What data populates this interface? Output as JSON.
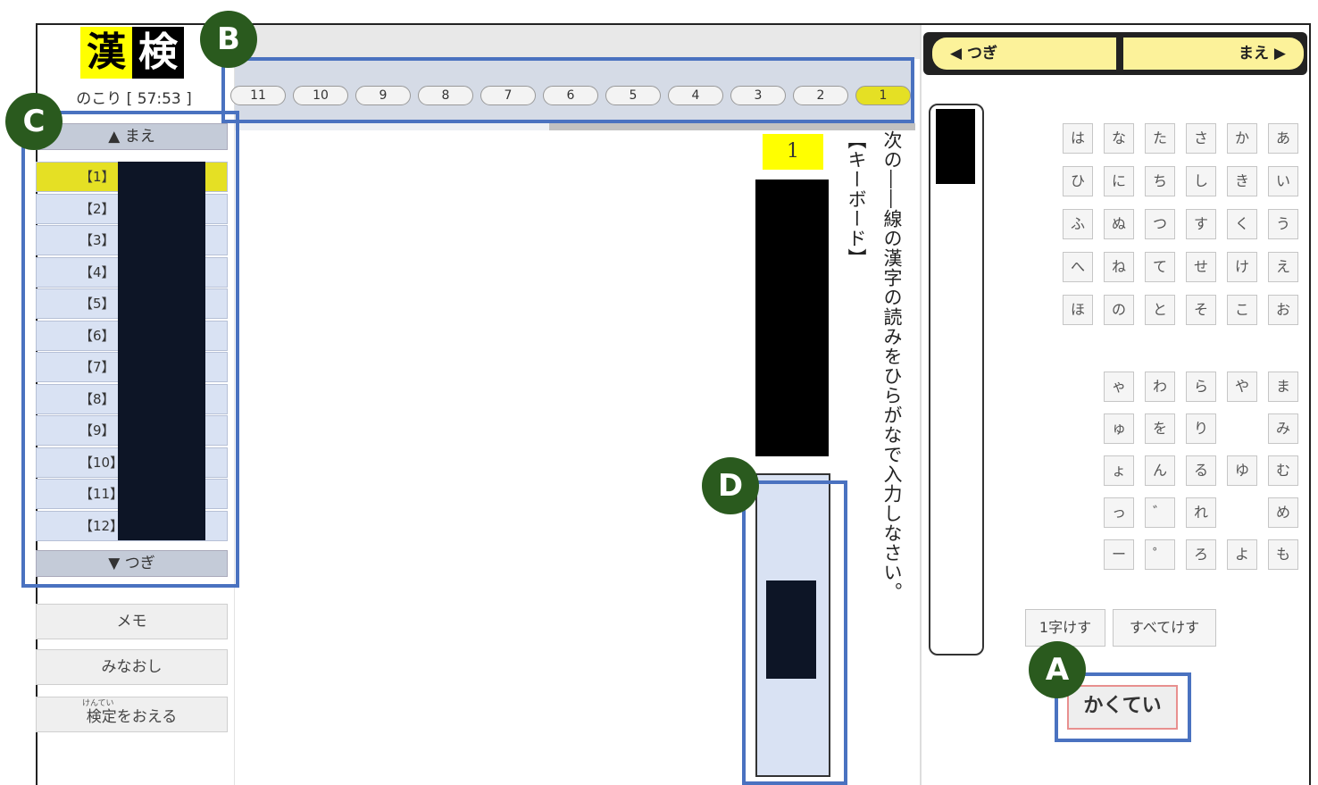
{
  "logo": {
    "char1": "漢",
    "char2": "検"
  },
  "timer": "のこり [ 57:53 ]",
  "sidebar": {
    "up_label": "▲ まえ",
    "down_label": "▼ つぎ",
    "questions": [
      "【1】",
      "【2】",
      "【3】",
      "【4】",
      "【5】",
      "【6】",
      "【7】",
      "【8】",
      "【9】",
      "【10】",
      "【11】",
      "【12】"
    ],
    "memo_label": "メモ",
    "review_label": "みなおし",
    "finish_label": "検定をおえる",
    "finish_ruby": "けんてい"
  },
  "tabs": [
    "11",
    "10",
    "9",
    "8",
    "7",
    "6",
    "5",
    "4",
    "3",
    "2",
    "1"
  ],
  "question": {
    "number": "1",
    "instruction": "次の――線の漢字の読みをひらがなで入力しなさい。",
    "input_label": "【キーボード】"
  },
  "nav": {
    "next_label": "◀ つぎ",
    "prev_label": "まえ ▶"
  },
  "keyboard": {
    "rows_top": [
      [
        "は",
        "な",
        "た",
        "さ",
        "か",
        "あ"
      ],
      [
        "ひ",
        "に",
        "ち",
        "し",
        "き",
        "い"
      ],
      [
        "ふ",
        "ぬ",
        "つ",
        "す",
        "く",
        "う"
      ],
      [
        "へ",
        "ね",
        "て",
        "せ",
        "け",
        "え"
      ],
      [
        "ほ",
        "の",
        "と",
        "そ",
        "こ",
        "お"
      ]
    ],
    "rows_bottom": [
      [
        "ゃ",
        "わ",
        "ら",
        "や",
        "ま"
      ],
      [
        "ゅ",
        "を",
        "り",
        "",
        "み"
      ],
      [
        "ょ",
        "ん",
        "る",
        "ゆ",
        "む"
      ],
      [
        "っ",
        "゛",
        "れ",
        "",
        "め"
      ],
      [
        "ー",
        "゜",
        "ろ",
        "よ",
        "も"
      ]
    ],
    "delete_one_label": "1字けす",
    "delete_all_label": "すべてけす",
    "confirm_label": "かくてい"
  },
  "annotations": {
    "a": "A",
    "b": "B",
    "c": "C",
    "d": "D"
  },
  "colors": {
    "highlight": "#e5e024",
    "marker": "#2a5a1e",
    "annotation_box": "#4a72c0"
  }
}
